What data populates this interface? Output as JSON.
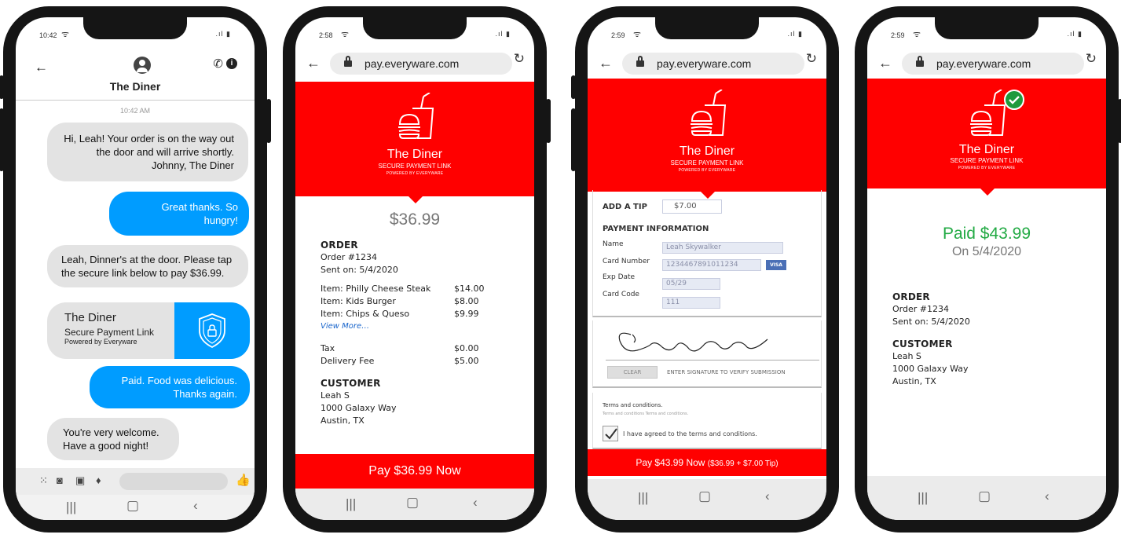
{
  "phone1": {
    "status": {
      "time": "10:42"
    },
    "contact": {
      "name": "The Diner"
    },
    "timestamp": "10:42 AM",
    "messages": [
      {
        "from": "in",
        "text": "Hi, Leah! Your order is on the way out the door and will arrive shortly. Johnny, The Diner"
      },
      {
        "from": "out",
        "text": "Great thanks. So hungry!"
      },
      {
        "from": "in",
        "text": "Leah, Dinner's at the door. Please tap the secure link below to pay $36.99."
      },
      {
        "from": "out",
        "text": "Paid. Food was delicious. Thanks again."
      },
      {
        "from": "in",
        "text": "You're very welcome. Have a good night!"
      }
    ],
    "link_card": {
      "title": "The Diner",
      "subtitle": "Secure Payment Link",
      "powered": "Powered by Everyware"
    }
  },
  "browser": {
    "url": "pay.everyware.com"
  },
  "brand": {
    "name": "The Diner",
    "tagline": "SECURE PAYMENT LINK",
    "powered": "POWERED BY EVERYWARE"
  },
  "phone2": {
    "status": {
      "time": "2:58"
    },
    "amount": "$36.99",
    "order": {
      "heading": "ORDER",
      "number": "Order #1234",
      "sent": "Sent on: 5/4/2020",
      "items": [
        {
          "label": "Item: Philly Cheese Steak",
          "price": "$14.00"
        },
        {
          "label": "Item: Kids Burger",
          "price": "$8.00"
        },
        {
          "label": "Item: Chips & Queso",
          "price": "$9.99"
        }
      ],
      "view_more": "View More…",
      "fees": [
        {
          "label": "Tax",
          "price": "$0.00"
        },
        {
          "label": "Delivery Fee",
          "price": "$5.00"
        }
      ]
    },
    "customer": {
      "heading": "CUSTOMER",
      "name": "Leah S",
      "street": "1000 Galaxy Way",
      "city": "Austin, TX"
    },
    "pay_button": "Pay $36.99 Now"
  },
  "phone3": {
    "status": {
      "time": "2:59"
    },
    "tip": {
      "label": "ADD A TIP",
      "value": "$7.00"
    },
    "payment": {
      "heading": "PAYMENT INFORMATION",
      "name_label": "Name",
      "name_value": "Leah Skywalker",
      "card_label": "Card Number",
      "card_value": "1234467891011234",
      "card_brand": "VISA",
      "exp_label": "Exp Date",
      "exp_value": "05/29",
      "code_label": "Card Code",
      "code_value": "111"
    },
    "signature": {
      "clear": "CLEAR",
      "hint": "ENTER SIGNATURE TO VERIFY SUBMISSION"
    },
    "terms": {
      "title": "Terms and conditions.",
      "body": "Terms and conditions Terms and conditions.",
      "agree": "I have agreed to the terms and conditions."
    },
    "pay_button_main": "Pay $43.99 Now",
    "pay_button_detail": "($36.99 + $7.00 Tip)"
  },
  "phone4": {
    "status": {
      "time": "2:59"
    },
    "paid": "Paid $43.99",
    "paid_on": "On 5/4/2020",
    "order": {
      "heading": "ORDER",
      "number": "Order #1234",
      "sent": "Sent on: 5/4/2020"
    },
    "customer": {
      "heading": "CUSTOMER",
      "name": "Leah S",
      "street": "1000 Galaxy Way",
      "city": "Austin, TX"
    }
  },
  "colors": {
    "brand_red": "#ff0000",
    "bubble_blue": "#009cff",
    "paid_green": "#22aa44"
  },
  "icons": [
    "back-arrow-icon",
    "avatar-icon",
    "phone-icon",
    "info-icon",
    "wifi-icon",
    "lock-icon",
    "reload-icon",
    "burger-drink-logo-icon",
    "shield-lock-icon",
    "check-badge-icon",
    "checkbox-icon",
    "visa-icon",
    "camera-icon",
    "gallery-icon",
    "mic-icon",
    "apps-icon",
    "thumbs-up-icon",
    "recents-icon",
    "home-icon",
    "nav-back-icon"
  ]
}
